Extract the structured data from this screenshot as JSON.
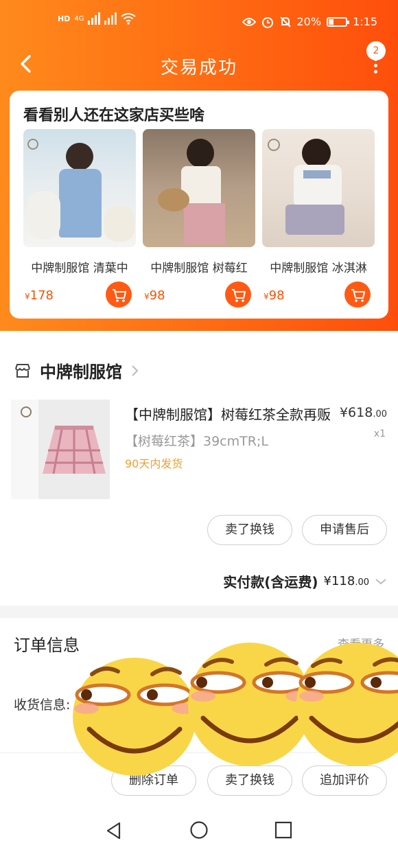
{
  "status_bar": {
    "network_tag": "HD",
    "net_type": "4G",
    "battery_percent": "20%",
    "time": "1:15"
  },
  "nav": {
    "title": "交易成功",
    "badge_count": "2"
  },
  "recommend": {
    "title": "看看别人还在这家店买些啥",
    "items": [
      {
        "name": "中牌制服馆 清葉中",
        "price_prefix": "¥",
        "price": "178"
      },
      {
        "name": "中牌制服馆 树莓红",
        "price_prefix": "¥",
        "price": "98"
      },
      {
        "name": "中牌制服馆 冰淇淋",
        "price_prefix": "¥",
        "price": "98"
      }
    ]
  },
  "shop": {
    "name": "中牌制服馆"
  },
  "product": {
    "title": "【中牌制服馆】树莓红茶全款再贩",
    "price_prefix": "¥",
    "price_int": "618",
    "price_dec": ".00",
    "sku": "【树莓红茶】39cmTR;L",
    "quantity": "x1",
    "shipping": "90天内发货"
  },
  "actions": {
    "sell_exchange": "卖了换钱",
    "after_sale": "申请售后"
  },
  "payment": {
    "label": "实付款(含运费)",
    "prefix": "¥",
    "amount_int": "118",
    "amount_dec": ".00"
  },
  "order_info": {
    "title": "订单信息",
    "view_more": "查看更多",
    "address_label": "收货信息:"
  },
  "bottom_actions": {
    "delete_order": "删除订单",
    "sell_exchange": "卖了换钱",
    "add_review": "追加评价"
  },
  "colors": {
    "brand_orange": "#ff5000",
    "header_gradient_start": "#ff8a1c",
    "header_gradient_end": "#ff4e0c",
    "shipping_text": "#f0a030"
  }
}
